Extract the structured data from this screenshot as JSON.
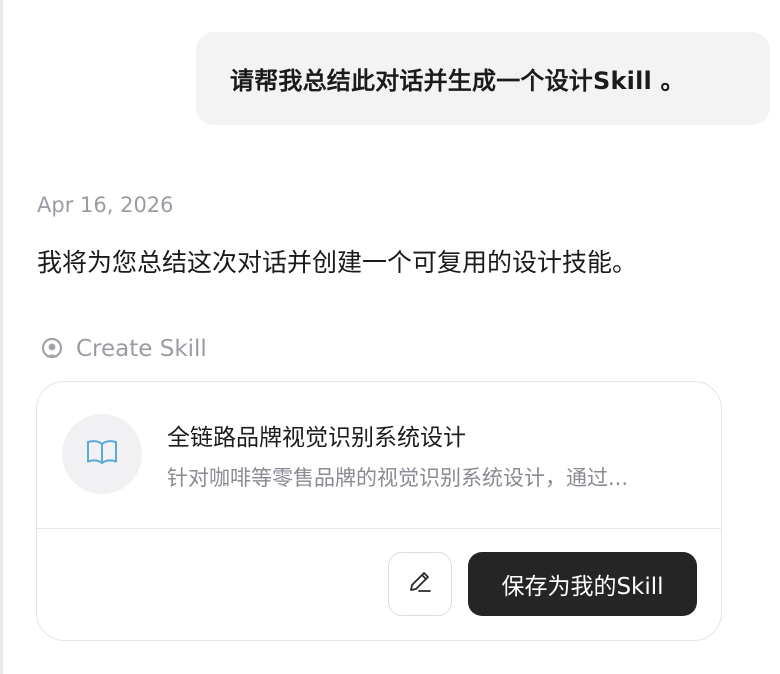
{
  "chat": {
    "user_message": "请帮我总结此对话并生成一个设计Skill 。",
    "date": "Apr 16, 2026",
    "assistant_message": "我将为您总结这次对话并创建一个可复用的设计技能。"
  },
  "tool_call": {
    "icon": "create-skill-icon",
    "label": "Create Skill"
  },
  "skill_card": {
    "icon": "book-open-icon",
    "title": "全链路品牌视觉识别系统设计",
    "description": "针对咖啡等零售品牌的视觉识别系统设计，通过...",
    "edit_icon": "pencil-icon",
    "save_label": "保存为我的Skill"
  },
  "colors": {
    "user_bubble_bg": "#f3f3f4",
    "muted_text": "#9b9ba3",
    "primary_button_bg": "#252525",
    "book_icon": "#5aa9d6"
  }
}
